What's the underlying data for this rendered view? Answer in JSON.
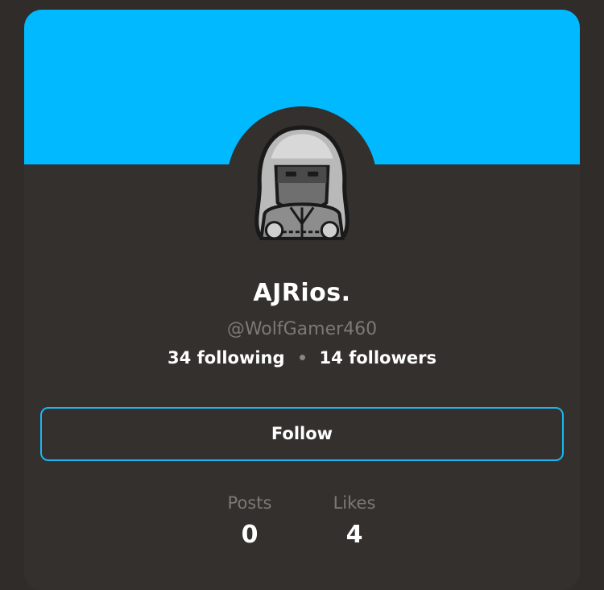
{
  "profile": {
    "display_name": "AJRios.",
    "username": "@WolfGamer460",
    "following": "34 following",
    "followers": "14 followers",
    "avatar_icon": "hooded-character-avatar"
  },
  "actions": {
    "follow_label": "Follow"
  },
  "counters": [
    {
      "label": "Posts",
      "value": "0"
    },
    {
      "label": "Likes",
      "value": "4"
    }
  ],
  "colors": {
    "banner": "#00b9ff",
    "accent": "#1cb6f2",
    "background": "#2f2c29",
    "card": "#33302d"
  }
}
